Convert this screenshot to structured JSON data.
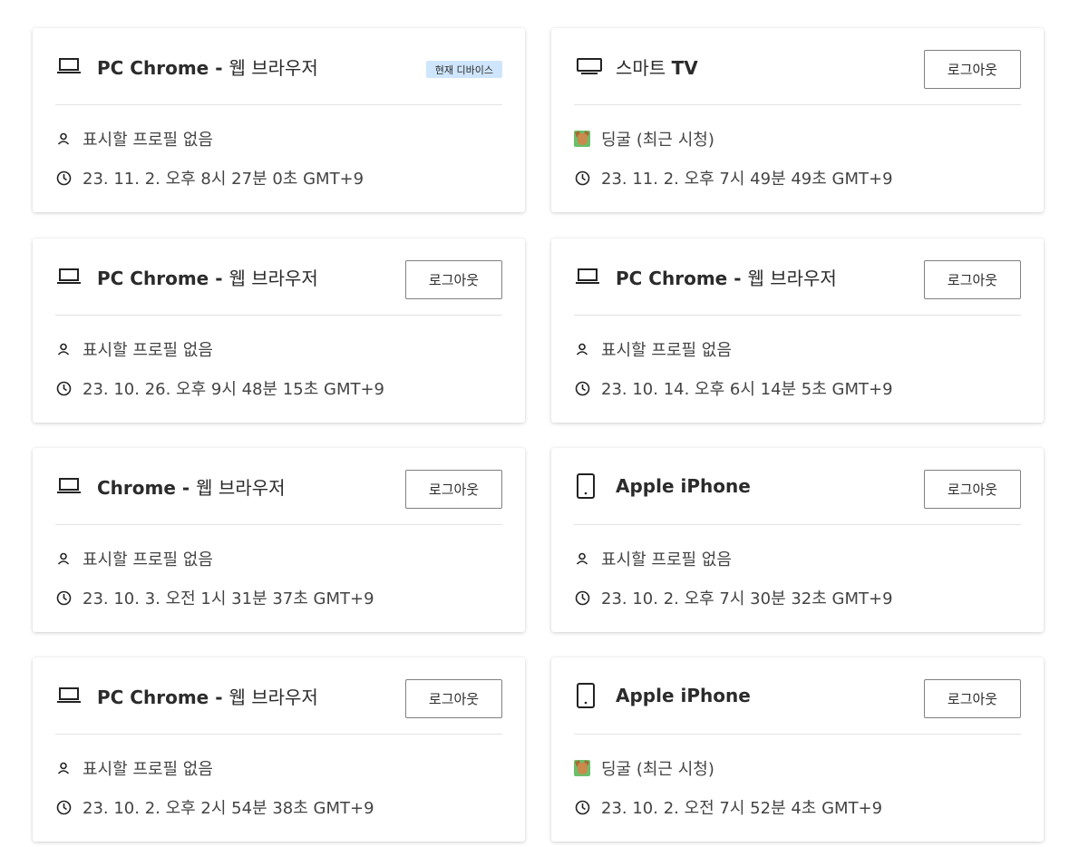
{
  "logout_label": "로그아웃",
  "current_device_badge": "현재 디바이스",
  "colors": {
    "badge_bg": "#cfe5fb",
    "border": "#e3e3e3",
    "button_border": "#808080"
  },
  "cards": [
    {
      "device_icon": "laptop-icon",
      "title_bold": "PC Chrome",
      "title_sep": " - ",
      "title_rest": "웹 브라우저",
      "badge": "현재 디바이스",
      "profile": "표시할 프로필 없음",
      "profile_icon": "person-icon",
      "time": "23. 11. 2. 오후 8시 27분 0초 GMT+9"
    },
    {
      "device_icon": "tv-icon",
      "title_bold": "TV",
      "title_prefix": "스마트 ",
      "profile": "딩굴 (최근 시청)",
      "profile_icon": "avatar-icon",
      "time": "23. 11. 2. 오후 7시 49분 49초 GMT+9"
    },
    {
      "device_icon": "laptop-icon",
      "title_bold": "PC Chrome",
      "title_sep": " - ",
      "title_rest": "웹 브라우저",
      "profile": "표시할 프로필 없음",
      "profile_icon": "person-icon",
      "time": "23. 10. 26. 오후 9시 48분 15초 GMT+9"
    },
    {
      "device_icon": "laptop-icon",
      "title_bold": "PC Chrome",
      "title_sep": " - ",
      "title_rest": "웹 브라우저",
      "profile": "표시할 프로필 없음",
      "profile_icon": "person-icon",
      "time": "23. 10. 14. 오후 6시 14분 5초 GMT+9"
    },
    {
      "device_icon": "laptop-icon",
      "title_bold": "Chrome",
      "title_sep": " - ",
      "title_rest": "웹 브라우저",
      "profile": "표시할 프로필 없음",
      "profile_icon": "person-icon",
      "time": "23. 10. 3. 오전 1시 31분 37초 GMT+9"
    },
    {
      "device_icon": "phone-icon",
      "title_bold": "Apple iPhone",
      "profile": "표시할 프로필 없음",
      "profile_icon": "person-icon",
      "time": "23. 10. 2. 오후 7시 30분 32초 GMT+9"
    },
    {
      "device_icon": "laptop-icon",
      "title_bold": "PC Chrome",
      "title_sep": " - ",
      "title_rest": "웹 브라우저",
      "profile": "표시할 프로필 없음",
      "profile_icon": "person-icon",
      "time": "23. 10. 2. 오후 2시 54분 38초 GMT+9"
    },
    {
      "device_icon": "phone-icon",
      "title_bold": "Apple iPhone",
      "profile": "딩굴 (최근 시청)",
      "profile_icon": "avatar-icon",
      "time": "23. 10. 2. 오전 7시 52분 4초 GMT+9"
    }
  ]
}
